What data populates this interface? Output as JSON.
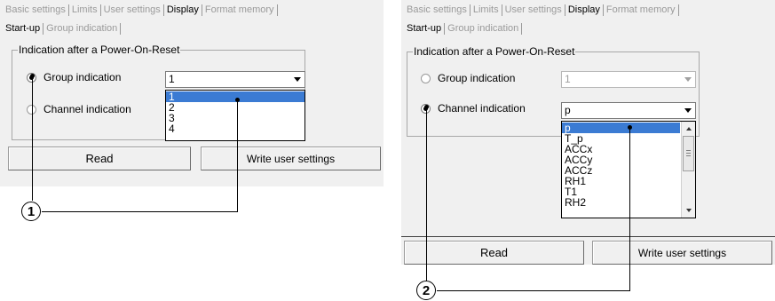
{
  "colors": {
    "window_bg": "#f0f0f0",
    "selection": "#3b7bd3",
    "disabled_text": "#a0a0a0"
  },
  "left": {
    "main_tabs": [
      {
        "label": "Basic settings",
        "active": false
      },
      {
        "label": "Limits",
        "active": false
      },
      {
        "label": "User settings",
        "active": false
      },
      {
        "label": "Display",
        "active": true
      },
      {
        "label": "Format memory",
        "active": false
      }
    ],
    "sub_tabs": [
      {
        "label": "Start-up",
        "active": true
      },
      {
        "label": "Group indication",
        "active": false
      }
    ],
    "groupbox_title": "Indication after a Power-On-Reset",
    "radio_group": {
      "label": "Group indication",
      "checked": true
    },
    "radio_channel": {
      "label": "Channel indication",
      "checked": false
    },
    "combo_value": "1",
    "dropdown_options": [
      "1",
      "2",
      "3",
      "4"
    ],
    "dropdown_selected": "1",
    "read_button": "Read",
    "write_button": "Write user settings",
    "callout": "1"
  },
  "right": {
    "main_tabs": [
      {
        "label": "Basic settings",
        "active": false
      },
      {
        "label": "Limits",
        "active": false
      },
      {
        "label": "User settings",
        "active": false
      },
      {
        "label": "Display",
        "active": true
      },
      {
        "label": "Format memory",
        "active": false
      }
    ],
    "sub_tabs": [
      {
        "label": "Start-up",
        "active": true
      },
      {
        "label": "Group indication",
        "active": false
      }
    ],
    "groupbox_title": "Indication after a Power-On-Reset",
    "radio_group": {
      "label": "Group indication",
      "checked": false
    },
    "radio_channel": {
      "label": "Channel indication",
      "checked": true
    },
    "group_combo_value": "1",
    "channel_combo_value": "p",
    "dropdown_options": [
      "p",
      "T_p",
      "ACCx",
      "ACCy",
      "ACCz",
      "RH1",
      "T1",
      "RH2"
    ],
    "dropdown_selected": "p",
    "read_button": "Read",
    "write_button": "Write user settings",
    "callout": "2"
  }
}
